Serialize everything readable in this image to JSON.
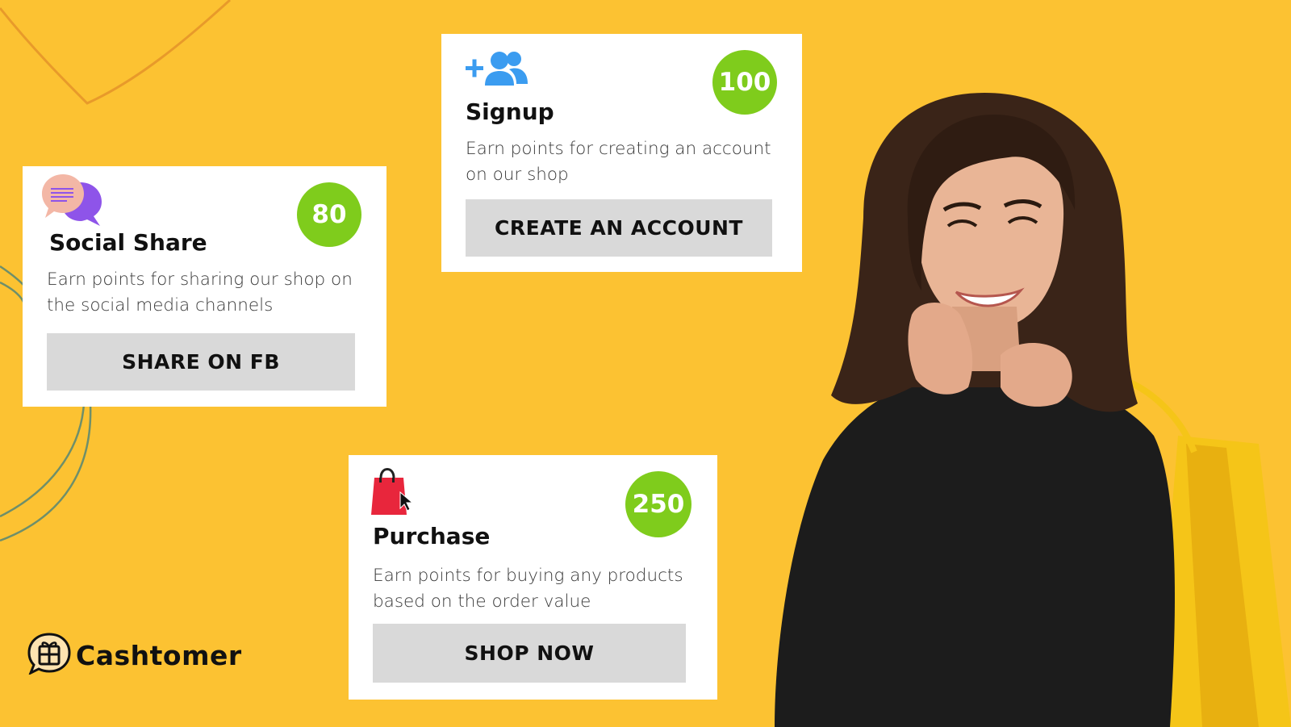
{
  "colors": {
    "background": "#fcc232",
    "card": "#ffffff",
    "badge": "#7fcc1c",
    "button": "#d9d9d9",
    "signup_icon": "#3b9cf0",
    "chat_icon_front": "#8e54e9",
    "chat_icon_back": "#f3b7a6",
    "bag_icon": "#e8263c"
  },
  "cards": {
    "signup": {
      "icon": "add-users-icon",
      "points": "100",
      "title": "Signup",
      "description": "Earn points for creating an account on our shop",
      "button_label": "CREATE AN ACCOUNT"
    },
    "social": {
      "icon": "chat-bubbles-icon",
      "points": "80",
      "title": "Social Share",
      "description": "Earn points for sharing our shop on the social media channels",
      "button_label": "SHARE ON FB"
    },
    "purchase": {
      "icon": "shopping-bag-icon",
      "points": "250",
      "title": "Purchase",
      "description": "Earn points for buying any products based on the order value",
      "button_label": "SHOP NOW"
    }
  },
  "brand": {
    "name": "Cashtomer",
    "icon": "gift-chat-icon"
  },
  "hero": {
    "icon": "smiling-woman-shopping-bag-photo"
  }
}
